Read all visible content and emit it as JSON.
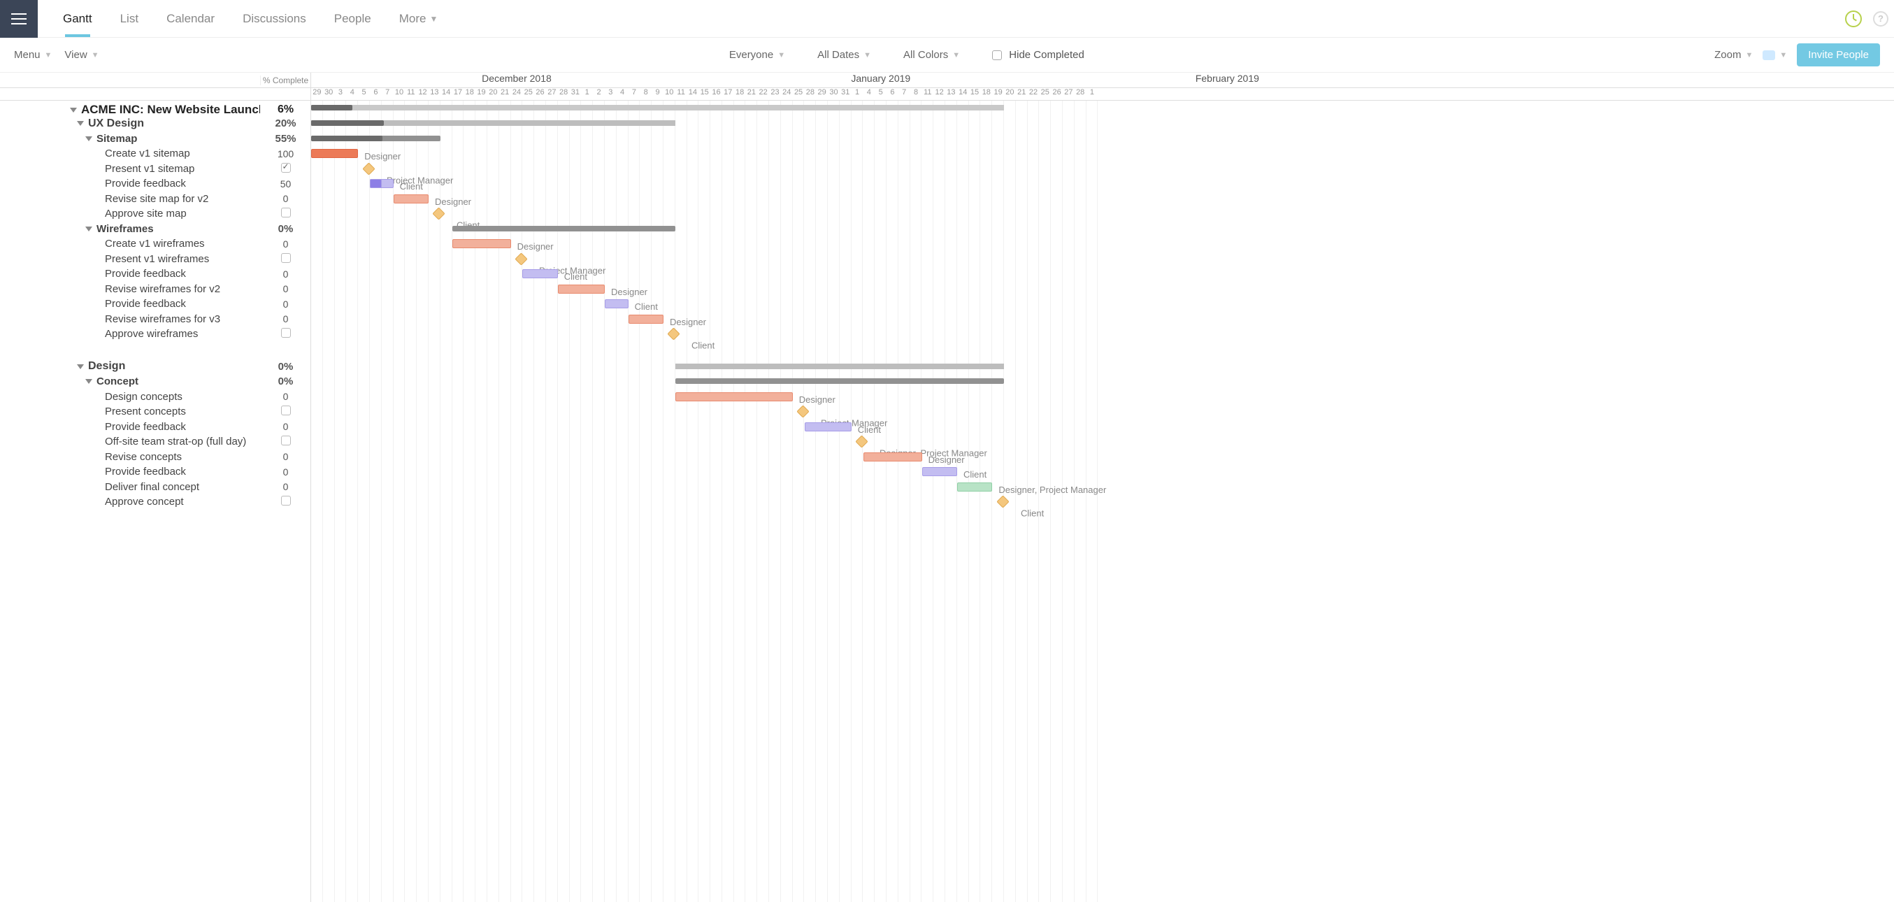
{
  "nav": {
    "tabs": [
      "Gantt",
      "List",
      "Calendar",
      "Discussions",
      "People",
      "More"
    ],
    "active": "Gantt"
  },
  "filters": {
    "menu_label": "Menu",
    "view_label": "View",
    "everyone": "Everyone",
    "all_dates": "All Dates",
    "all_colors": "All Colors",
    "hide_completed": "Hide Completed",
    "zoom_label": "Zoom",
    "invite_label": "Invite People"
  },
  "columns": {
    "pct_label": "% Complete"
  },
  "project": {
    "title": "ACME INC: New Website Launch",
    "pct": "6%"
  },
  "timeline": {
    "start": "2018-11-29",
    "months": [
      {
        "label": "",
        "days": 2
      },
      {
        "label": "December 2018",
        "days": 31
      },
      {
        "label": "January 2019",
        "days": 31
      },
      {
        "label": "February 2019",
        "days": 28
      }
    ],
    "day_labels": [
      "29",
      "30",
      "3",
      "4",
      "5",
      "6",
      "7",
      "10",
      "11",
      "12",
      "13",
      "14",
      "17",
      "18",
      "19",
      "20",
      "21",
      "24",
      "25",
      "26",
      "27",
      "28",
      "31",
      "1",
      "2",
      "3",
      "4",
      "7",
      "8",
      "9",
      "10",
      "11",
      "14",
      "15",
      "16",
      "17",
      "18",
      "21",
      "22",
      "23",
      "24",
      "25",
      "28",
      "29",
      "30",
      "31",
      "1",
      "4",
      "5",
      "6",
      "7",
      "8",
      "11",
      "12",
      "13",
      "14",
      "15",
      "18",
      "19",
      "20",
      "21",
      "22",
      "25",
      "26",
      "27",
      "28",
      "1"
    ],
    "colw": 16.8
  },
  "rows": [
    {
      "t": "header",
      "lvl": 0,
      "name": "ACME INC: New Website Launch",
      "pct": "6%",
      "bar": {
        "type": "summary-top",
        "s": 0,
        "e": 59,
        "progress": 0.06
      }
    },
    {
      "t": "group",
      "lvl": 1,
      "name": "UX Design",
      "pct": "20%",
      "bar": {
        "type": "summary",
        "s": 0,
        "e": 31,
        "progress": 0.2
      }
    },
    {
      "t": "group",
      "lvl": 2,
      "name": "Sitemap",
      "pct": "55%",
      "bar": {
        "type": "sub",
        "s": 0,
        "e": 11,
        "progress": 0.55
      }
    },
    {
      "t": "task",
      "lvl": 3,
      "name": "Create v1 sitemap",
      "pct": "100",
      "bar": {
        "type": "orange-solid",
        "s": 0,
        "e": 4,
        "label": "Designer"
      }
    },
    {
      "t": "task",
      "lvl": 3,
      "name": "Present v1 sitemap",
      "pct": "cb-checked",
      "bar": {
        "type": "milestone",
        "x": 4.5,
        "label": "Project Manager"
      }
    },
    {
      "t": "task",
      "lvl": 3,
      "name": "Provide feedback",
      "pct": "50",
      "bar": {
        "type": "purple",
        "s": 5,
        "e": 7,
        "progress": 0.5,
        "label": "Client"
      }
    },
    {
      "t": "task",
      "lvl": 3,
      "name": "Revise site map for v2",
      "pct": "0",
      "bar": {
        "type": "orange",
        "s": 7,
        "e": 10,
        "label": "Designer"
      }
    },
    {
      "t": "task",
      "lvl": 3,
      "name": "Approve site map",
      "pct": "cb",
      "bar": {
        "type": "milestone",
        "x": 10.5,
        "label": "Client"
      }
    },
    {
      "t": "group",
      "lvl": 2,
      "name": "Wireframes",
      "pct": "0%",
      "bar": {
        "type": "sub",
        "s": 12,
        "e": 31
      }
    },
    {
      "t": "task",
      "lvl": 3,
      "name": "Create v1 wireframes",
      "pct": "0",
      "bar": {
        "type": "orange",
        "s": 12,
        "e": 17,
        "label": "Designer"
      }
    },
    {
      "t": "task",
      "lvl": 3,
      "name": "Present v1 wireframes",
      "pct": "cb",
      "bar": {
        "type": "milestone",
        "x": 17.5,
        "label": "Project Manager"
      }
    },
    {
      "t": "task",
      "lvl": 3,
      "name": "Provide feedback",
      "pct": "0",
      "bar": {
        "type": "purple",
        "s": 18,
        "e": 21,
        "label": "Client"
      }
    },
    {
      "t": "task",
      "lvl": 3,
      "name": "Revise wireframes for v2",
      "pct": "0",
      "bar": {
        "type": "orange",
        "s": 21,
        "e": 25,
        "label": "Designer"
      }
    },
    {
      "t": "task",
      "lvl": 3,
      "name": "Provide feedback",
      "pct": "0",
      "bar": {
        "type": "purple",
        "s": 25,
        "e": 27,
        "label": "Client"
      }
    },
    {
      "t": "task",
      "lvl": 3,
      "name": "Revise wireframes for v3",
      "pct": "0",
      "bar": {
        "type": "orange",
        "s": 27,
        "e": 30,
        "label": "Designer"
      }
    },
    {
      "t": "task",
      "lvl": 3,
      "name": "Approve wireframes",
      "pct": "cb",
      "bar": {
        "type": "milestone",
        "x": 30.5,
        "label": "Client"
      }
    },
    {
      "t": "spacer"
    },
    {
      "t": "group",
      "lvl": 1,
      "name": "Design",
      "pct": "0%",
      "bar": {
        "type": "summary",
        "s": 31,
        "e": 59
      }
    },
    {
      "t": "group",
      "lvl": 2,
      "name": "Concept",
      "pct": "0%",
      "bar": {
        "type": "sub",
        "s": 31,
        "e": 59
      }
    },
    {
      "t": "task",
      "lvl": 3,
      "name": "Design concepts",
      "pct": "0",
      "bar": {
        "type": "orange",
        "s": 31,
        "e": 41,
        "label": "Designer"
      }
    },
    {
      "t": "task",
      "lvl": 3,
      "name": "Present concepts",
      "pct": "cb",
      "bar": {
        "type": "milestone",
        "x": 41.5,
        "label": "Project Manager"
      }
    },
    {
      "t": "task",
      "lvl": 3,
      "name": "Provide feedback",
      "pct": "0",
      "bar": {
        "type": "purple",
        "s": 42,
        "e": 46,
        "label": "Client"
      }
    },
    {
      "t": "task",
      "lvl": 3,
      "name": "Off-site team strat-op (full day)",
      "pct": "cb",
      "bar": {
        "type": "milestone",
        "x": 46.5,
        "label": "Designer, Project Manager"
      }
    },
    {
      "t": "task",
      "lvl": 3,
      "name": "Revise concepts",
      "pct": "0",
      "bar": {
        "type": "orange",
        "s": 47,
        "e": 52,
        "label": "Designer"
      }
    },
    {
      "t": "task",
      "lvl": 3,
      "name": "Provide feedback",
      "pct": "0",
      "bar": {
        "type": "purple",
        "s": 52,
        "e": 55,
        "label": "Client"
      }
    },
    {
      "t": "task",
      "lvl": 3,
      "name": "Deliver final concept",
      "pct": "0",
      "bar": {
        "type": "green",
        "s": 55,
        "e": 58,
        "label": "Designer, Project Manager"
      }
    },
    {
      "t": "task",
      "lvl": 3,
      "name": "Approve concept",
      "pct": "cb",
      "bar": {
        "type": "milestone",
        "x": 58.5,
        "label": "Client"
      }
    }
  ]
}
